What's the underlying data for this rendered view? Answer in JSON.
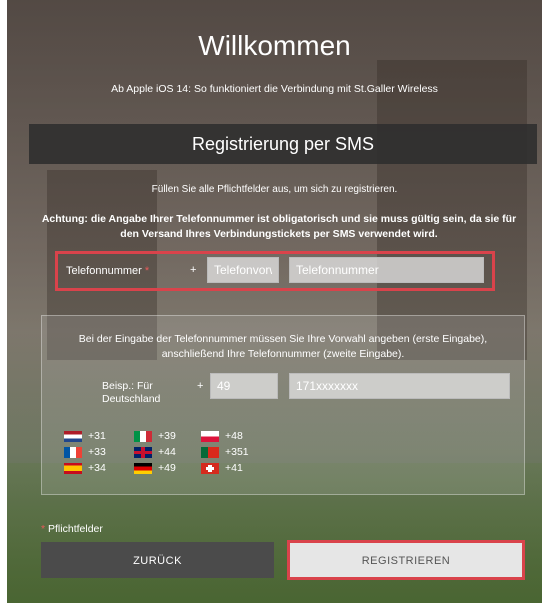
{
  "title": "Willkommen",
  "subtitle": "Ab Apple iOS 14: So funktioniert die Verbindung mit St.Galler Wireless",
  "section_title": "Registrierung per SMS",
  "instruction": "Füllen Sie alle Pflichtfelder aus, um sich zu registrieren.",
  "warning": "Achtung: die Angabe Ihrer Telefonnummer ist obligatorisch und sie muss gültig sein, da sie für den Versand Ihres Verbindungstickets per SMS verwendet wird.",
  "phone": {
    "label": "Telefonnummer",
    "required_mark": "*",
    "plus": "+",
    "prefix_placeholder": "Telefonvorwahl",
    "number_placeholder": "Telefonnummer"
  },
  "example_box": {
    "info": "Bei der Eingabe der Telefonnummer müssen Sie Ihre Vorwahl angeben (erste Eingabe), anschließend Ihre Telefonnummer (zweite Eingabe).",
    "example_label_line1": "Beisp.: Für",
    "example_label_line2": "Deutschland",
    "plus": "+",
    "example_prefix": "49",
    "example_number": "171xxxxxxx",
    "codes": [
      {
        "flag": "nl",
        "code": "+31"
      },
      {
        "flag": "fr",
        "code": "+33"
      },
      {
        "flag": "es",
        "code": "+34"
      },
      {
        "flag": "it",
        "code": "+39"
      },
      {
        "flag": "gb",
        "code": "+44"
      },
      {
        "flag": "de",
        "code": "+49"
      },
      {
        "flag": "pl",
        "code": "+48"
      },
      {
        "flag": "pt",
        "code": "+351"
      },
      {
        "flag": "ch",
        "code": "+41"
      }
    ]
  },
  "required_note": {
    "mark": "*",
    "text": "Pflichtfelder"
  },
  "buttons": {
    "back": "ZURÜCK",
    "register": "REGISTRIEREN"
  },
  "colors": {
    "highlight": "#d9434b",
    "band": "#2d2d2d",
    "back_button": "#4b4b4b",
    "register_button": "#e6e6e6"
  }
}
